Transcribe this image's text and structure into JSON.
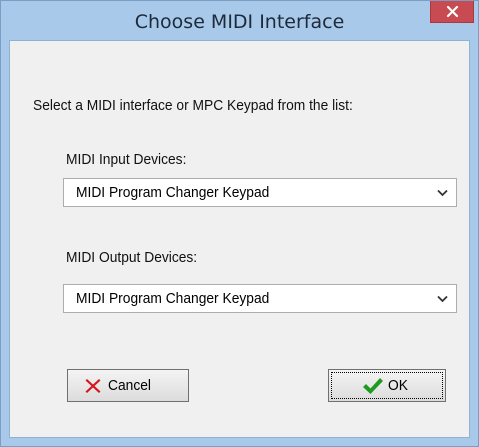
{
  "window": {
    "title": "Choose MIDI Interface",
    "close_glyph": "×"
  },
  "dialog": {
    "instruction": "Select a MIDI interface or MPC Keypad from the list:",
    "input_label": "MIDI Input Devices:",
    "input_selected": "MIDI Program Changer Keypad",
    "output_label": "MIDI Output Devices:",
    "output_selected": "MIDI Program Changer Keypad"
  },
  "buttons": {
    "cancel_label": "Cancel",
    "cancel_icon": "red-x-icon",
    "ok_label": "OK",
    "ok_icon": "green-checkmark-icon"
  },
  "colors": {
    "titlebar": "#a9c9ea",
    "close_button": "#c74b50",
    "cancel_icon": "#d8141c",
    "ok_icon": "#1f9a1f"
  }
}
